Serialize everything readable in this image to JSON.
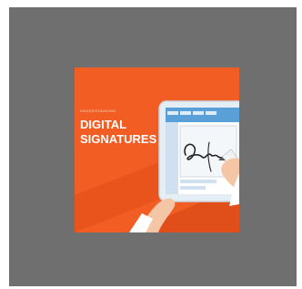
{
  "thumbnail": {
    "kicker": "UNDERSTANDING",
    "title_line_1": "DIGITAL",
    "title_line_2": "SIGNATURES",
    "background_color": "#f15d22",
    "frame_color": "#6f6f6f"
  }
}
